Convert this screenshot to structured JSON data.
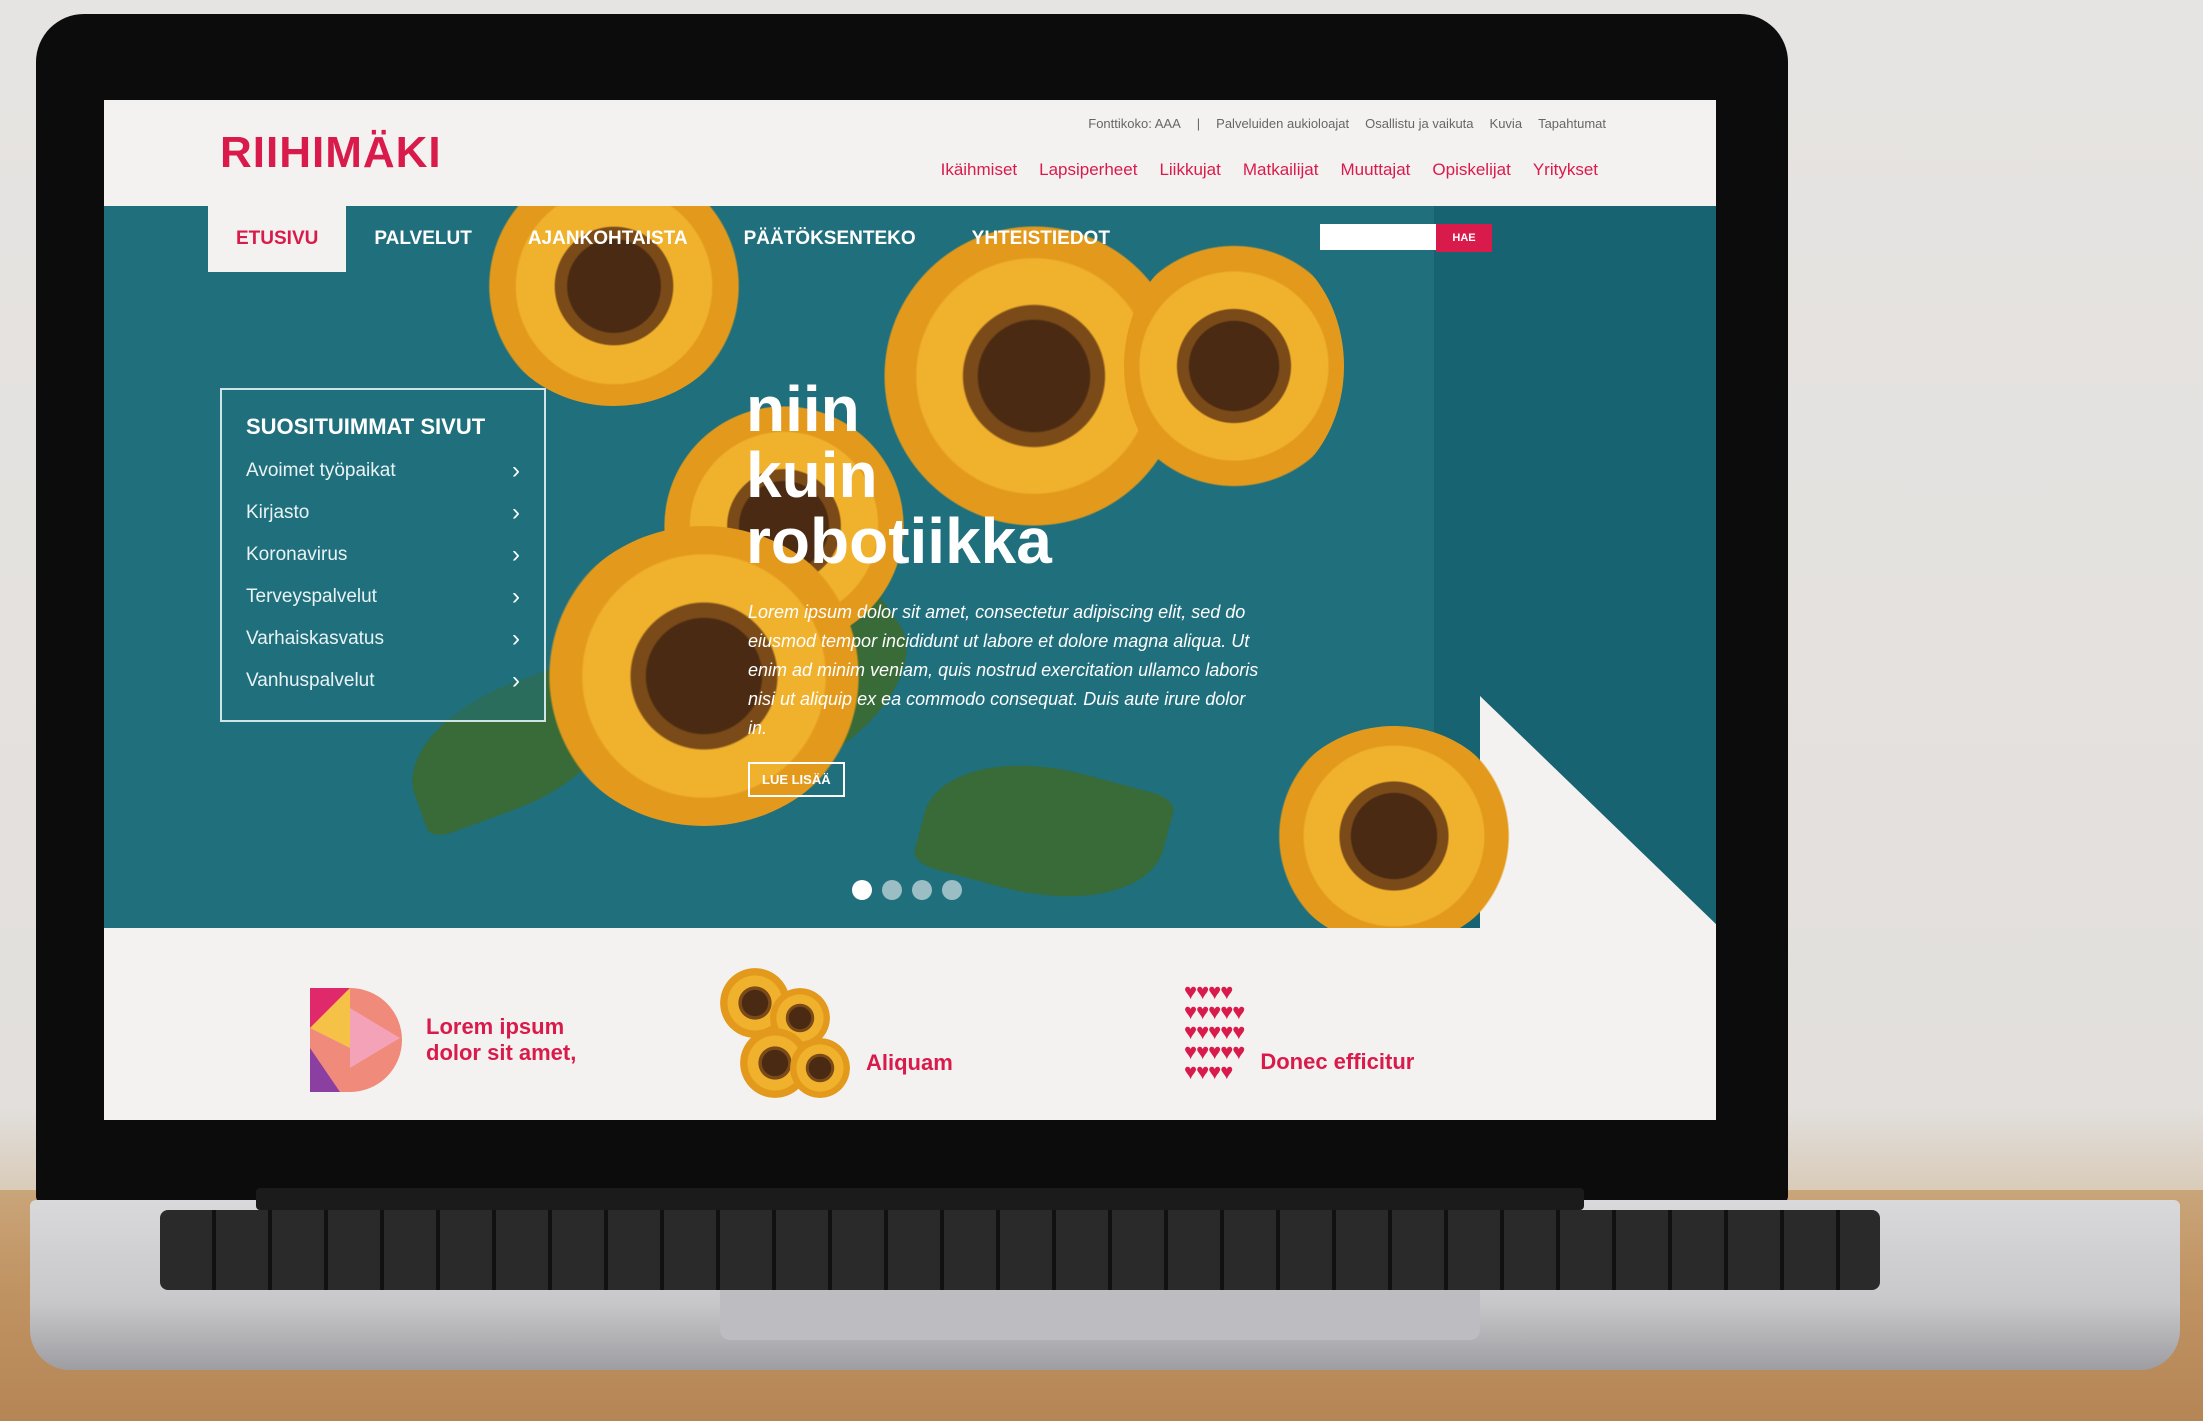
{
  "site": {
    "logo": "RIIHIMÄKI",
    "utility_links": [
      "Fonttikoko: AAA",
      "|",
      "Palveluiden aukioloajat",
      "Osallistu ja vaikuta",
      "Kuvia",
      "Tapahtumat"
    ],
    "audience_links": [
      "Ikäihmiset",
      "Lapsiperheet",
      "Liikkujat",
      "Matkailijat",
      "Muuttajat",
      "Opiskelijat",
      "Yritykset"
    ],
    "nav": [
      {
        "label": "ETUSIVU",
        "active": true
      },
      {
        "label": "PALVELUT",
        "active": false
      },
      {
        "label": "AJANKOHTAISTA",
        "active": false
      },
      {
        "label": "PÄÄTÖKSENTEKO",
        "active": false
      },
      {
        "label": "YHTEISTIEDOT",
        "active": false
      }
    ],
    "search": {
      "placeholder": "",
      "button_label": "HAE"
    },
    "popular": {
      "title": "SUOSITUIMMAT SIVUT",
      "items": [
        "Avoimet työpaikat",
        "Kirjasto",
        "Koronavirus",
        "Terveyspalvelut",
        "Varhaiskasvatus",
        "Vanhuspalvelut"
      ]
    },
    "hero": {
      "headline_lines": [
        "niin",
        "kuin",
        "robotiikka"
      ],
      "lead": "Lorem ipsum dolor sit amet, consectetur adipiscing elit, sed do eiusmod tempor incididunt ut labore et dolore magna aliqua. Ut enim ad minim veniam, quis nostrud exercitation ullamco laboris nisi ut aliquip ex ea commodo consequat. Duis aute irure dolor in.",
      "read_more": "LUE LISÄÄ",
      "slide_count": 4,
      "active_slide": 0
    },
    "cards": [
      {
        "title_lines": [
          "Lorem ipsum",
          "dolor sit amet,"
        ],
        "icon": "d-letter-icon"
      },
      {
        "title_lines": [
          "Aliquam"
        ],
        "icon": "sunflower-icon"
      },
      {
        "title_lines": [
          "Donec efficitur"
        ],
        "icon": "hearts-icon"
      }
    ],
    "colors": {
      "brand": "#d91b4b",
      "teal": "#1f6f7d"
    }
  }
}
